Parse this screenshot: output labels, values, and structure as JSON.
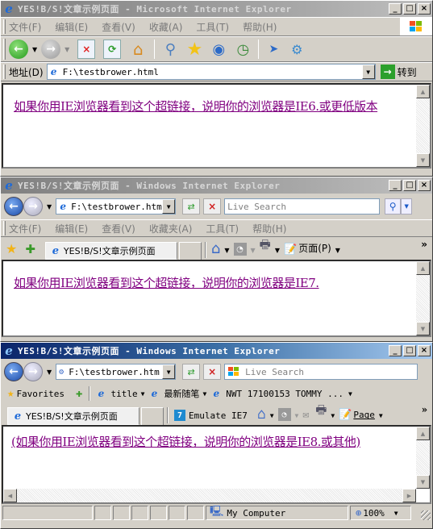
{
  "ie6": {
    "title": "YES!B/S!文章示例页面 - Microsoft Internet Explorer",
    "menu": [
      "文件(F)",
      "编辑(E)",
      "查看(V)",
      "收藏(A)",
      "工具(T)",
      "帮助(H)"
    ],
    "address_label": "地址(D)",
    "address_value": "F:\\testbrower.html",
    "go_label": "转到",
    "link_text": "如果你用IE浏览器看到这个超链接，说明你的浏览器是IE6.或更低版本"
  },
  "ie7": {
    "title": "YES!B/S!文章示例页面 - Windows Internet Explorer",
    "address_value": "F:\\testbrower.html",
    "search_placeholder": "Live Search",
    "menu": [
      "文件(F)",
      "编辑(E)",
      "查看(V)",
      "收藏夹(A)",
      "工具(T)",
      "帮助(H)"
    ],
    "tab_title": "YES!B/S!文章示例页面",
    "page_menu_label": "页面(P)",
    "chevron_label": "»",
    "link_text": "如果你用IE浏览器看到这个超链接，说明你的浏览器是IE7."
  },
  "ie8": {
    "title": "YES!B/S!文章示例页面 - Windows Internet Explorer",
    "address_value": "F:\\testbrower.htm",
    "search_placeholder": "Live Search",
    "favorites_label": "Favorites",
    "fav_links": [
      "title",
      "最新随笔",
      "NWT 17100153 TOMMY ..."
    ],
    "tab_title": "YES!B/S!文章示例页面",
    "emulate_label": "Emulate IE7",
    "page_menu_label": "Page",
    "chevron_label": "»",
    "link_text": "(如果你用IE浏览器看到这个超链接，说明你的浏览器是IE8.或其他)",
    "status_zone": "My Computer",
    "zoom_level": "100%"
  },
  "caption": {
    "minimize": "_",
    "maximize": "□",
    "close": "×"
  }
}
